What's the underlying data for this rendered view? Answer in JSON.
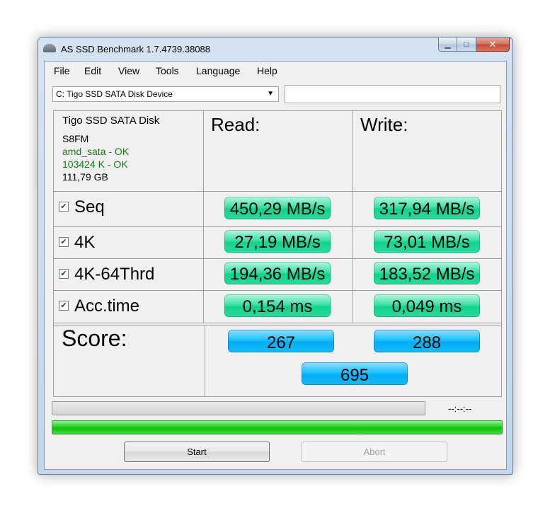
{
  "window": {
    "title": "AS SSD Benchmark 1.7.4739.38088"
  },
  "menu": [
    "File",
    "Edit",
    "View",
    "Tools",
    "Language",
    "Help"
  ],
  "drive_select": {
    "selected": "C: Tigo SSD  SATA Disk Device"
  },
  "drive_info": {
    "name": "Tigo SSD  SATA Disk",
    "firmware": "S8FM",
    "driver_status": "amd_sata - OK",
    "alignment_status": "103424 K - OK",
    "capacity": "111,79 GB",
    "ok_color": "#1a7a1a"
  },
  "headers": {
    "read": "Read:",
    "write": "Write:"
  },
  "tests": [
    {
      "label": "Seq",
      "checked": true,
      "read": "450,29 MB/s",
      "write": "317,94 MB/s"
    },
    {
      "label": "4K",
      "checked": true,
      "read": "27,19 MB/s",
      "write": "73,01 MB/s"
    },
    {
      "label": "4K-64Thrd",
      "checked": true,
      "read": "194,36 MB/s",
      "write": "183,52 MB/s"
    },
    {
      "label": "Acc.time",
      "checked": true,
      "read": "0,154 ms",
      "write": "0,049 ms"
    }
  ],
  "score": {
    "label": "Score:",
    "read": "267",
    "write": "288",
    "total": "695"
  },
  "time_elapsed": "--:--:--",
  "progress": {
    "top_fraction": 0.0,
    "bottom_fraction": 1.0
  },
  "buttons": {
    "start": "Start",
    "abort": "Abort"
  },
  "colors": {
    "result_green": "#10d48e",
    "score_blue": "#02aef3",
    "progress_green": "#21d321"
  }
}
